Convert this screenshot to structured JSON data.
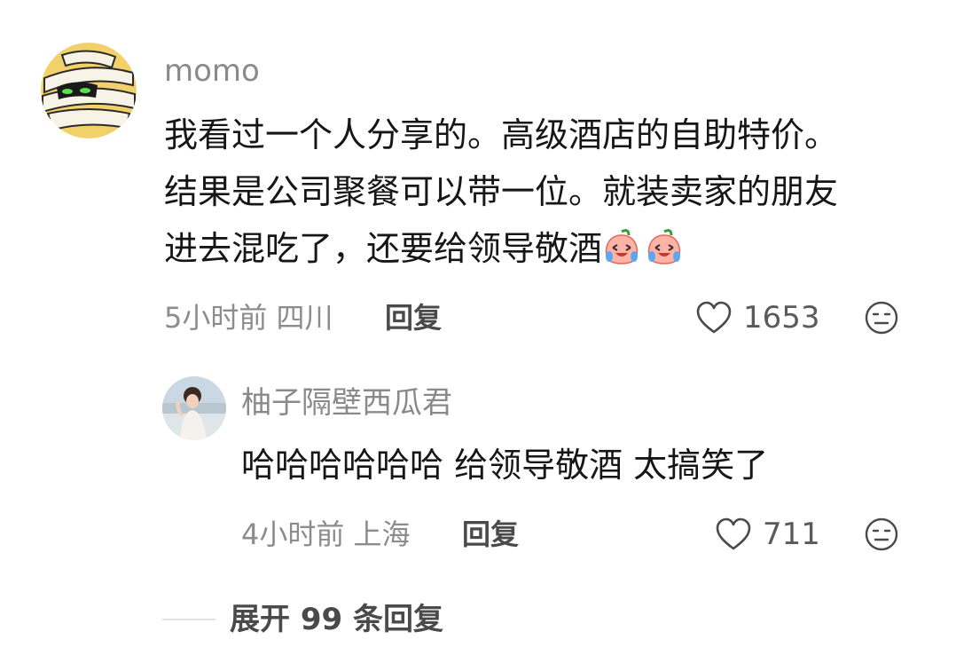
{
  "comments": [
    {
      "username": "momo",
      "lines": [
        "我看过一个人分享的。高级酒店的自助特价。",
        "结果是公司聚餐可以带一位。就装卖家的朋友",
        "进去混吃了，还要给领导敬酒"
      ],
      "emoji_icon": "crying-laughing-peach-emoji",
      "time": "5小时前",
      "location": "四川",
      "reply_label": "回复",
      "likes": "1653"
    },
    {
      "username": "柚子隔壁西瓜君",
      "text": "哈哈哈哈哈哈 给领导敬酒 太搞笑了",
      "time": "4小时前",
      "location": "上海",
      "reply_label": "回复",
      "likes": "711"
    }
  ],
  "expand_label": "展开 99 条回复",
  "icons": {
    "like": "heart-outline-icon",
    "dislike": "meh-face-icon"
  },
  "colors": {
    "username": "#8a8a8a",
    "body_text": "#161616",
    "meta": "#8c8c8c",
    "action": "#4a4a4a"
  }
}
